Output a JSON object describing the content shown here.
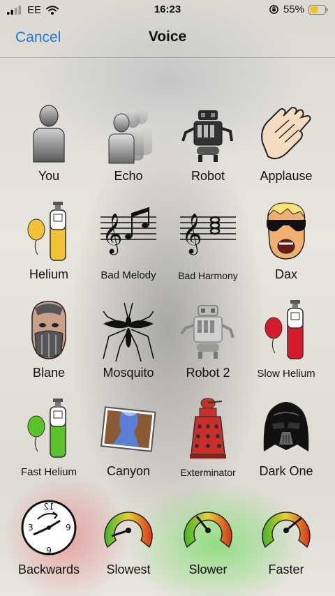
{
  "status_bar": {
    "carrier": "EE",
    "time": "16:23",
    "battery": "55%"
  },
  "nav": {
    "cancel_label": "Cancel",
    "title": "Voice"
  },
  "voices": [
    {
      "label": "You",
      "icon": "person-icon"
    },
    {
      "label": "Echo",
      "icon": "echo-icon"
    },
    {
      "label": "Robot",
      "icon": "robot-icon"
    },
    {
      "label": "Applause",
      "icon": "clapping-hands-icon"
    },
    {
      "label": "Helium",
      "icon": "helium-balloon-icon"
    },
    {
      "label": "Bad Melody",
      "icon": "music-staff-icon"
    },
    {
      "label": "Bad Harmony",
      "icon": "music-chord-icon"
    },
    {
      "label": "Dax",
      "icon": "sunglasses-face-icon"
    },
    {
      "label": "Blane",
      "icon": "masked-face-icon"
    },
    {
      "label": "Mosquito",
      "icon": "mosquito-icon"
    },
    {
      "label": "Robot 2",
      "icon": "robot-2-icon"
    },
    {
      "label": "Slow Helium",
      "icon": "slow-helium-balloon-icon"
    },
    {
      "label": "Fast Helium",
      "icon": "fast-helium-balloon-icon"
    },
    {
      "label": "Canyon",
      "icon": "canyon-icon"
    },
    {
      "label": "Exterminator",
      "icon": "dalek-icon"
    },
    {
      "label": "Dark One",
      "icon": "dark-helmet-icon"
    },
    {
      "label": "Backwards",
      "icon": "backwards-clock-icon"
    },
    {
      "label": "Slowest",
      "icon": "speed-gauge-icon"
    },
    {
      "label": "Slower",
      "icon": "speed-gauge-icon"
    },
    {
      "label": "Faster",
      "icon": "speed-gauge-icon"
    }
  ],
  "colors": {
    "accent": "#1f7ae0",
    "battery": "#f3c21c"
  }
}
